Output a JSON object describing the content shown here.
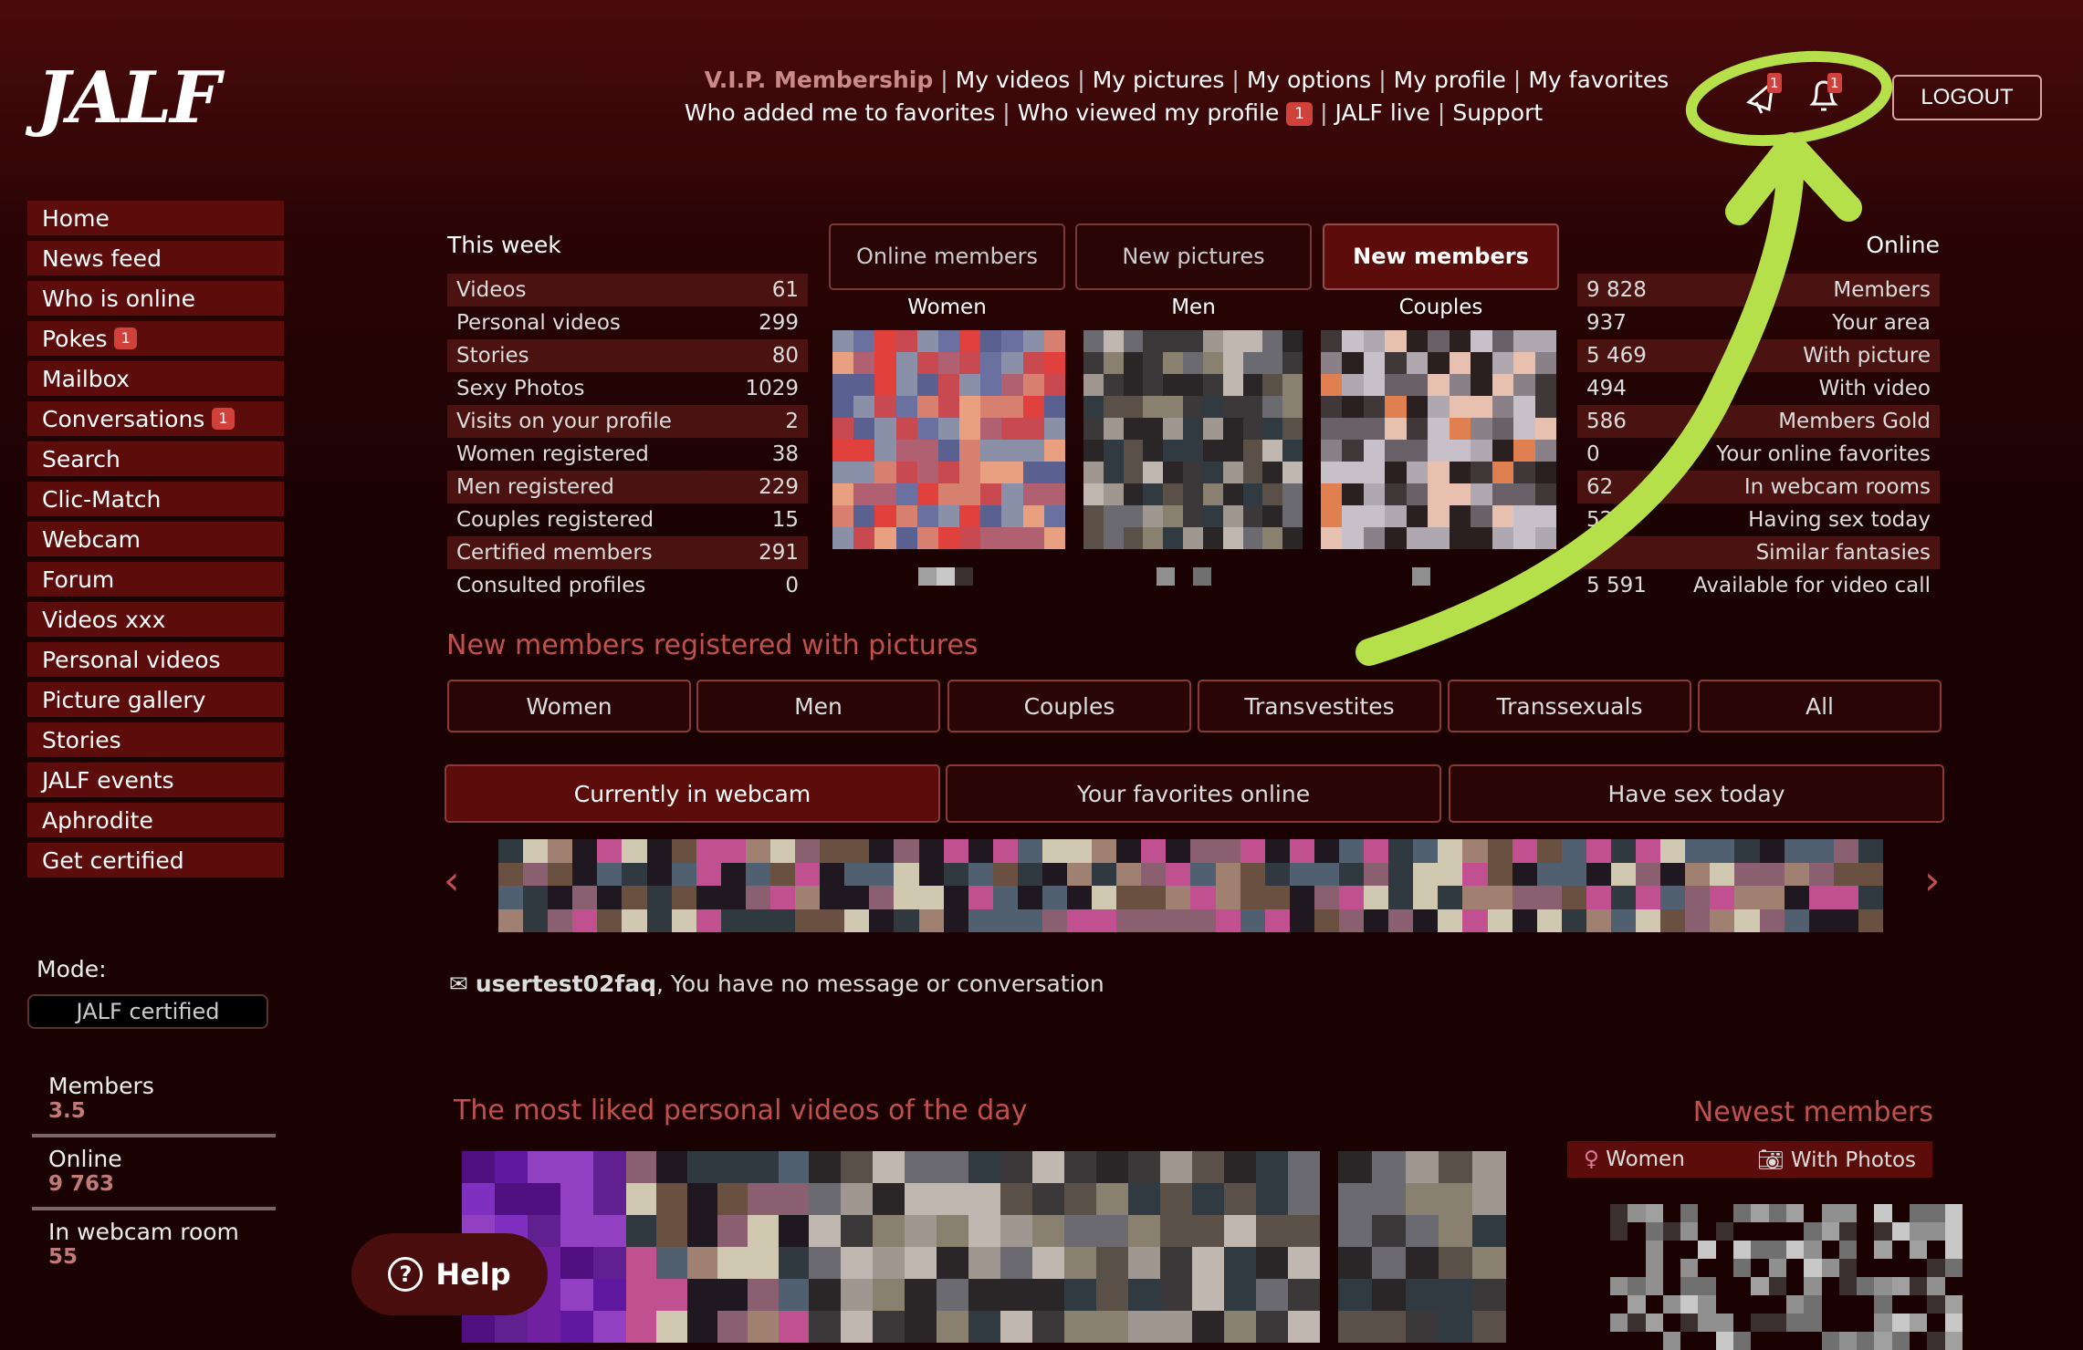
{
  "brand": {
    "logo": "JALF"
  },
  "topnav": {
    "row1": [
      "V.I.P. Membership",
      "My videos",
      "My pictures",
      "My options",
      "My profile",
      "My favorites"
    ],
    "row2": [
      "Who added me to favorites",
      "Who viewed my profile",
      "JALF live",
      "Support"
    ],
    "viewed_badge": "1",
    "notif_badge": "1",
    "bell_badge": "1",
    "logout": "LOGOUT"
  },
  "sidebar": {
    "items": [
      {
        "label": "Home"
      },
      {
        "label": "News feed"
      },
      {
        "label": "Who is online"
      },
      {
        "label": "Pokes",
        "badge": "1"
      },
      {
        "label": "Mailbox"
      },
      {
        "label": "Conversations",
        "badge": "1"
      },
      {
        "label": "Search"
      },
      {
        "label": "Clic-Match"
      },
      {
        "label": "Webcam"
      },
      {
        "label": "Forum"
      },
      {
        "label": "Videos xxx"
      },
      {
        "label": "Personal videos"
      },
      {
        "label": "Picture gallery"
      },
      {
        "label": "Stories"
      },
      {
        "label": "JALF events"
      },
      {
        "label": "Aphrodite"
      },
      {
        "label": "Get certified"
      }
    ],
    "mode_label": "Mode:",
    "mode_value": "JALF certified",
    "stats": [
      {
        "label": "Members",
        "value": "3.5"
      },
      {
        "label": "Online",
        "value": "9 763"
      },
      {
        "label": "In webcam room",
        "value": "55"
      }
    ]
  },
  "help": "Help",
  "this_week": {
    "title": "This week",
    "rows": [
      [
        "Videos",
        "61"
      ],
      [
        "Personal videos",
        "299"
      ],
      [
        "Stories",
        "80"
      ],
      [
        "Sexy Photos",
        "1029"
      ],
      [
        "Visits on your profile",
        "2"
      ],
      [
        "Women registered",
        "38"
      ],
      [
        "Men registered",
        "229"
      ],
      [
        "Couples registered",
        "15"
      ],
      [
        "Certified members",
        "291"
      ],
      [
        "Consulted profiles",
        "0"
      ]
    ]
  },
  "tabs": [
    {
      "label": "Online members",
      "sub": "Women"
    },
    {
      "label": "New pictures",
      "sub": "Men"
    },
    {
      "label": "New members",
      "sub": "Couples",
      "active": true
    }
  ],
  "online": {
    "title": "Online",
    "rows": [
      [
        "9 828",
        "Members"
      ],
      [
        "937",
        "Your area"
      ],
      [
        "5 469",
        "With picture"
      ],
      [
        "494",
        "With video"
      ],
      [
        "586",
        "Members Gold"
      ],
      [
        "0",
        "Your online favorites"
      ],
      [
        "62",
        "In webcam rooms"
      ],
      [
        "52",
        "Having sex today"
      ],
      [
        "",
        "Similar fantasies"
      ],
      [
        "5 591",
        "Available for video call"
      ]
    ]
  },
  "new_members": {
    "title": "New members registered with pictures",
    "filters": [
      "Women",
      "Men",
      "Couples",
      "Transvestites",
      "Transsexuals",
      "All"
    ]
  },
  "webcam_tabs": [
    {
      "label": "Currently in webcam",
      "active": true
    },
    {
      "label": "Your favorites online"
    },
    {
      "label": "Have sex today"
    }
  ],
  "message": {
    "user": "usertest02faq",
    "text": ", You have no message or conversation"
  },
  "videos": {
    "title": "The most liked personal videos of the day"
  },
  "newest": {
    "title": "Newest members",
    "filter_gender": "Women",
    "filter_photos": "With Photos"
  },
  "colors": {
    "accent": "#c0504d",
    "row": "#4a1210",
    "button": "#5c0d0b",
    "annotation": "#b5e04a",
    "badge": "#d0413c"
  }
}
